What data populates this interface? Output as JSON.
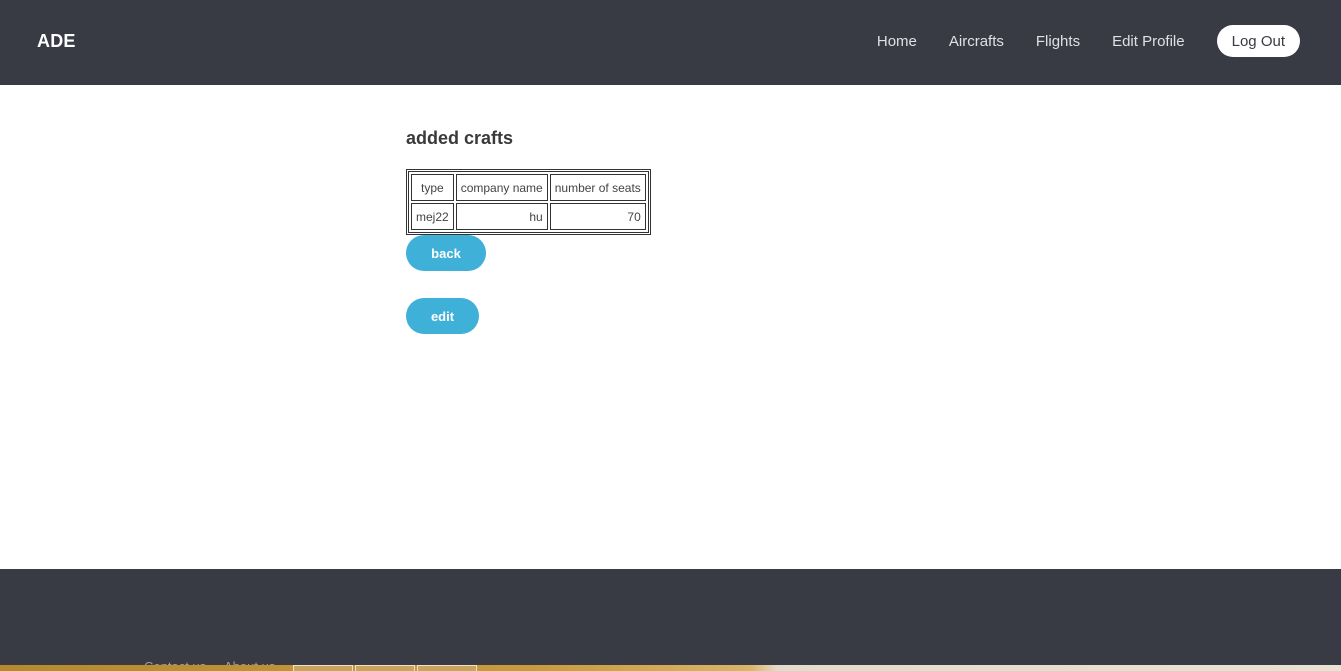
{
  "header": {
    "brand": "ADE",
    "nav": [
      "Home",
      "Aircrafts",
      "Flights",
      "Edit Profile"
    ],
    "logout_label": "Log Out"
  },
  "main": {
    "title": "added crafts",
    "table": {
      "headers": [
        "type",
        "company name",
        "number of seats"
      ],
      "rows": [
        [
          "mej22",
          "hu",
          "70"
        ]
      ]
    },
    "back_label": "back",
    "edit_label": "edit"
  },
  "footer": {
    "links": [
      "Contact us",
      "About us"
    ]
  },
  "colors": {
    "header_bg": "#393b44",
    "button_bg": "#3fb0d8",
    "footer_bg": "#393b44"
  }
}
